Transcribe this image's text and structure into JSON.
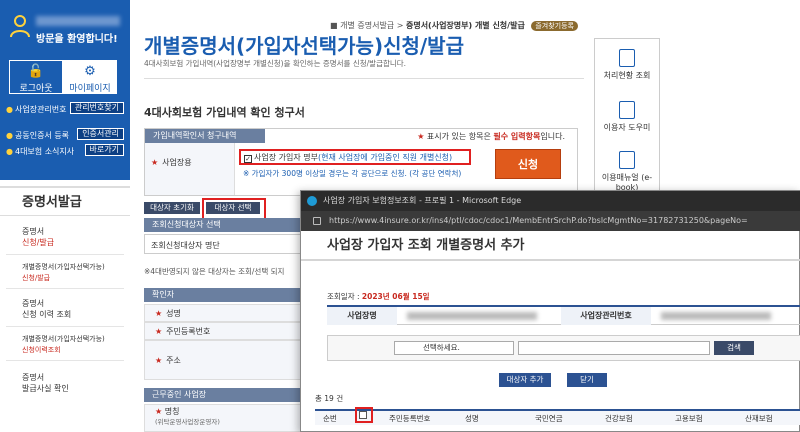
{
  "sidebar": {
    "welcome": "방문을 환영합니다!",
    "logout": "로그아웃",
    "mypage": "마이페이지",
    "links": [
      {
        "label": "사업장관리번호",
        "pill": "관리번호찾기"
      },
      {
        "label": "공동인증서 등록",
        "pill": "인증서관리"
      },
      {
        "label": "4대보험 소식지사",
        "pill": "바로가기"
      }
    ],
    "nav_title": "증명서발급",
    "nav_items": [
      {
        "line1": "증명서",
        "line2": "신청/발급"
      },
      {
        "line1": "개별증명서(가입자선택가능)",
        "line2": "신청/발급"
      },
      {
        "line1": "증명서",
        "line2": "신청 이력 조회"
      },
      {
        "line1": "개별증명서(가입자선택가능)",
        "line2": "신청이력조회"
      },
      {
        "line1": "증명서",
        "line2": "발급사실 확인"
      }
    ]
  },
  "main": {
    "breadcrumb_root": "개별 증명서발급",
    "breadcrumb_current": "증명서(사업장명부) 개별 신청/발급",
    "bookmark": "즐겨찾기등록",
    "page_title": "개별증명서(가입자선택가능)신청/발급",
    "page_desc": "4대사회보험 가입내역(사업장명부 개별신청)을 확인하는 증명서를 신청/발급합니다.",
    "section_title": "4대사회보험 가입내역 확인 청구서",
    "request_head": "가입내역확인서 청구내역",
    "required_mark": "★",
    "required_text_pre": "표시가 있는 항목은 ",
    "required_text_red": "필수 입력항목",
    "required_text_post": "입니다.",
    "workplace_label": "사업장용",
    "cert_option_label": "사업장 가입자 명부",
    "cert_option_detail": "(현재 사업장에 가입중인 직원 개별신청)",
    "cert_note": "※ 가입자가 300명 이상일 경우는 각 공단으로 신청. (각 공단 연락처)",
    "apply_button": "신청",
    "reset_button": "대상자 초기화",
    "select_button": "대상자 선택",
    "target_list_head": "조회신청대상자 선택",
    "target_list_row": "조회신청대상자 명단",
    "unreported_note": "※4대반영되지 않은 대상자는 조회/선택 되지",
    "confirmer_head": "확인자",
    "confirmer_rows": [
      "성명",
      "주민등록번호",
      "주소"
    ],
    "workplace_head": "근무중인 사업장",
    "workplace_name_label": "명칭",
    "workplace_name_sub": "(위탁운영사업장운영자)"
  },
  "quick_menu": {
    "items": [
      "처리현황 조회",
      "이용자 도우미",
      "이용매뉴얼 (e-book)"
    ]
  },
  "popup": {
    "window_title": "사업장 가입자 보험정보조회 - 프로필 1 - Microsoft Edge",
    "url": "https://www.4insure.or.kr/ins4/ptl/cdoc/cdoc1/MembEntrSrchP.do?bslcMgmtNo=31782731250&pageNo=",
    "header": "사업장 가입자 조회 개별증명서 추가",
    "inquiry_label": "조회일자 : ",
    "inquiry_date": "2023년 06월 15일",
    "workplace_name": "사업장명",
    "workplace_no": "사업장관리번호",
    "search_placeholder": "선택하세요.",
    "search_button": "검색",
    "add_target_button": "대상자 추가",
    "close_button": "닫기",
    "total_count": "총 19 건",
    "grid_headers": [
      "순번",
      "주민등록번호",
      "성명",
      "국민연금",
      "건강보험",
      "고용보험",
      "산재보험"
    ]
  },
  "colors": {
    "brand": "#1a5db0",
    "highlight_red": "#e02020",
    "apply_orange": "#e05a1c"
  }
}
